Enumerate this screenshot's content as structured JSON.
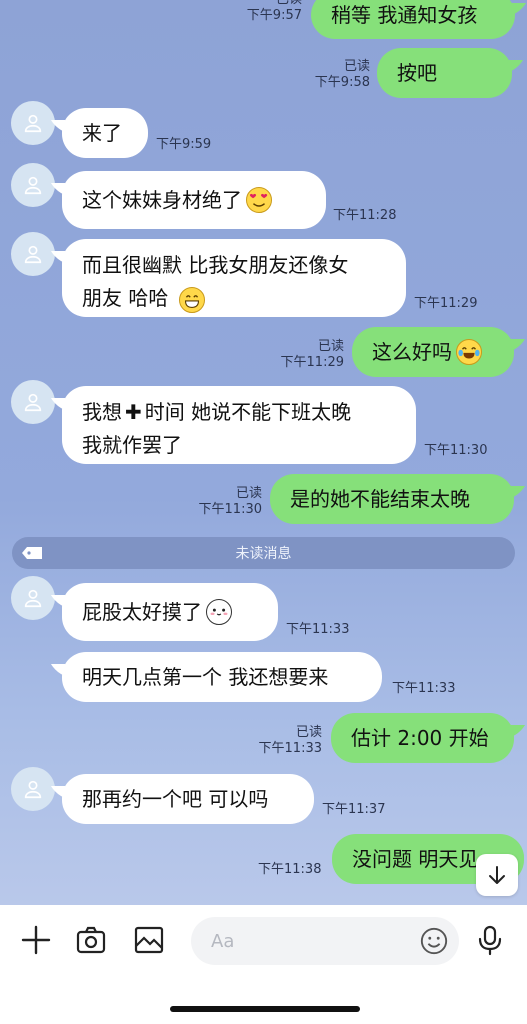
{
  "messages": [
    {
      "dir": "out",
      "text": "稍等 我通知女孩",
      "time": "下午9:57",
      "read": "已读"
    },
    {
      "dir": "out",
      "text": "按吧",
      "time": "下午9:58",
      "read": "已读"
    },
    {
      "dir": "in",
      "text": "来了",
      "time": "下午9:59"
    },
    {
      "dir": "in",
      "text": "这个妹妹身材绝了",
      "emoji": "heart-eyes",
      "time": "下午11:28"
    },
    {
      "dir": "in",
      "line1": "而且很幽默 比我女朋友还像女",
      "line2": "朋友 哈哈",
      "emoji": "grin",
      "time": "下午11:29"
    },
    {
      "dir": "out",
      "text": "这么好吗",
      "emoji": "tears",
      "time": "下午11:29",
      "read": "已读"
    },
    {
      "dir": "in",
      "line1a": "我想",
      "line1b": "时间 她说不能下班太晚",
      "line2": "我就作罢了",
      "time": "下午11:30"
    },
    {
      "dir": "out",
      "text": "是的她不能结束太晚",
      "time": "下午11:30",
      "read": "已读"
    },
    {
      "dir": "in",
      "text": "屁股太好摸了",
      "emoji": "bear",
      "time": "下午11:33"
    },
    {
      "dir": "in",
      "text": "明天几点第一个 我还想要来",
      "time": "下午11:33"
    },
    {
      "dir": "out",
      "text": "估计 2:00 开始",
      "time": "下午11:33",
      "read": "已读"
    },
    {
      "dir": "in",
      "text": "那再约一个吧 可以吗",
      "time": "下午11:37"
    },
    {
      "dir": "out",
      "text": "没问题 明天见",
      "time": "下午11:38"
    }
  ],
  "divider": {
    "label": "未读消息"
  },
  "input": {
    "placeholder": "Aa"
  },
  "icons": {
    "add": "plus-icon",
    "camera": "camera-icon",
    "gallery": "image-icon",
    "emoji": "smiley-icon",
    "voice": "microphone-icon",
    "scroll": "arrow-down-icon",
    "avatar": "user-silhouette-icon"
  },
  "colors": {
    "background": "#93a9dc",
    "outgoing_bubble": "#86e07a",
    "incoming_bubble": "#ffffff",
    "divider": "#7f93c4"
  }
}
